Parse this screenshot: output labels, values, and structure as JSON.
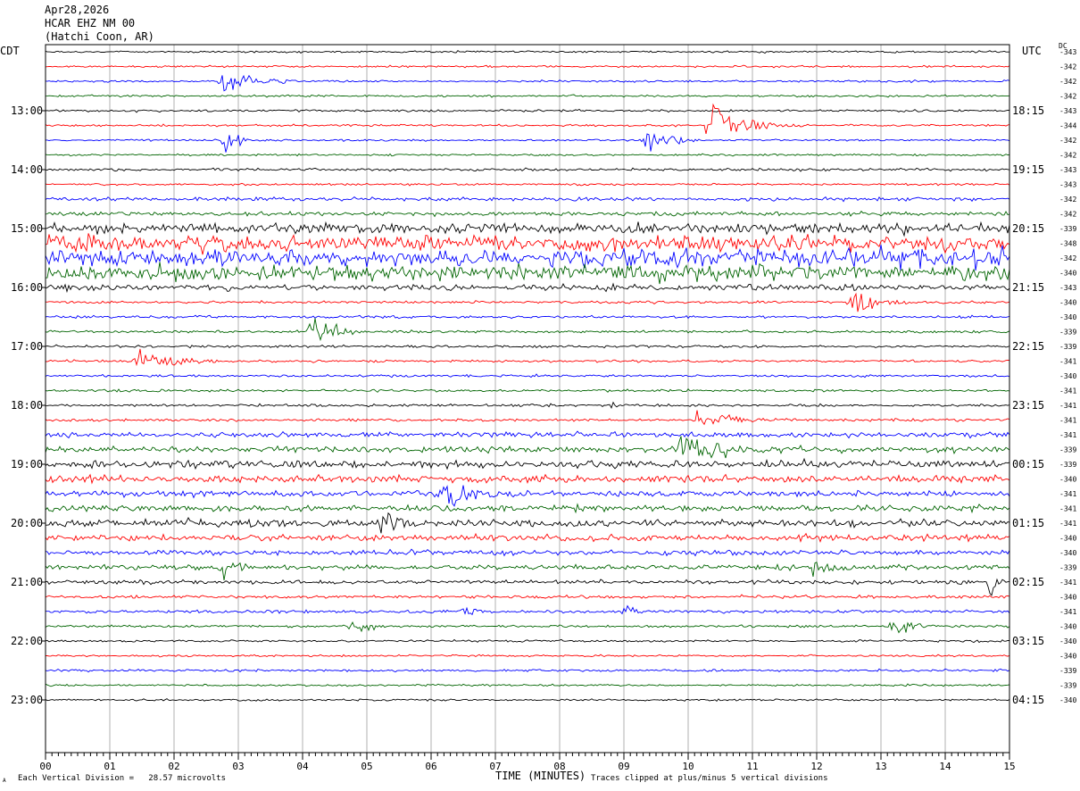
{
  "header": {
    "date": "Apr28,2026",
    "station": "HCAR EHZ NM 00",
    "location": "(Hatchi Coon, AR)"
  },
  "left_tz": "CDT",
  "right_tz": "UTC",
  "dc_label": "DC",
  "footer": {
    "scale": "Each Vertical Division =   28.57 microvolts",
    "clip": "Traces clipped at plus/minus 5 vertical divisions",
    "corner_mark": "A"
  },
  "colors": {
    "black": "#000000",
    "red": "#ff0000",
    "blue": "#0000ff",
    "green": "#006400",
    "grid": "#b0b0b0"
  },
  "chart_data": {
    "type": "line",
    "title": "",
    "xlabel": "TIME (MINUTES)",
    "ylabel": "",
    "x_ticks": [
      "00",
      "01",
      "02",
      "03",
      "04",
      "05",
      "06",
      "07",
      "08",
      "09",
      "10",
      "11",
      "12",
      "13",
      "14",
      "15"
    ],
    "xlim": [
      0,
      15
    ],
    "left_time_labels": [
      "13:00",
      "14:00",
      "15:00",
      "16:00",
      "17:00",
      "18:00",
      "19:00",
      "20:00",
      "21:00",
      "22:00",
      "23:00"
    ],
    "right_time_labels": [
      "18:15",
      "19:15",
      "20:15",
      "21:15",
      "22:15",
      "23:15",
      "00:15",
      "01:15",
      "02:15",
      "03:15",
      "04:15"
    ],
    "trace_color_cycle": [
      "black",
      "red",
      "blue",
      "green"
    ],
    "dc_offsets": [
      "-343",
      "-342",
      "-342",
      "-342",
      "-343",
      "-344",
      "-342",
      "-342",
      "-343",
      "-343",
      "-342",
      "-342",
      "-339",
      "-348",
      "-342",
      "-340",
      "-343",
      "-340",
      "-340",
      "-339",
      "-339",
      "-341",
      "-340",
      "-341",
      "-341",
      "-341",
      "-341",
      "-339",
      "-339",
      "-340",
      "-341",
      "-341",
      "-341",
      "-340",
      "-340",
      "-339",
      "-341",
      "-340",
      "-341",
      "-340",
      "-340",
      "-340",
      "-339",
      "-339",
      "-340"
    ],
    "noise_level": [
      1,
      1,
      1,
      1,
      1.1,
      1,
      1,
      1,
      1.3,
      1,
      1.8,
      2,
      5,
      8,
      9,
      8,
      3,
      1.2,
      1.3,
      1.3,
      1.2,
      1.2,
      1.2,
      1.2,
      1.3,
      1.4,
      2.5,
      3,
      3.5,
      3.5,
      3,
      3,
      3.5,
      3,
      2.5,
      2.5,
      2,
      1.5,
      1.5,
      1.2,
      1.1,
      1,
      1.2,
      1
    ],
    "events": [
      {
        "trace": 2,
        "minute": 2.8,
        "amplitude": 22,
        "duration": 0.8
      },
      {
        "trace": 6,
        "minute": 2.8,
        "amplitude": 18,
        "duration": 0.4
      },
      {
        "trace": 4,
        "minute": 1.4,
        "amplitude": 5,
        "duration": 0.1
      },
      {
        "trace": 6,
        "minute": 9.4,
        "amplitude": 16,
        "duration": 0.7
      },
      {
        "trace": 5,
        "minute": 10.4,
        "amplitude": 22,
        "duration": 1.0
      },
      {
        "trace": 17,
        "minute": 12.6,
        "amplitude": 14,
        "duration": 0.8
      },
      {
        "trace": 19,
        "minute": 4.2,
        "amplitude": 14,
        "duration": 0.8
      },
      {
        "trace": 21,
        "minute": 1.5,
        "amplitude": 18,
        "duration": 1.0
      },
      {
        "trace": 24,
        "minute": 8.8,
        "amplitude": 4,
        "duration": 0.3
      },
      {
        "trace": 25,
        "minute": 10.2,
        "amplitude": 12,
        "duration": 1.1
      },
      {
        "trace": 27,
        "minute": 10.0,
        "amplitude": 16,
        "duration": 1.3
      },
      {
        "trace": 30,
        "minute": 6.3,
        "amplitude": 16,
        "duration": 1.3
      },
      {
        "trace": 32,
        "minute": 5.3,
        "amplitude": 18,
        "duration": 0.8
      },
      {
        "trace": 35,
        "minute": 2.8,
        "amplitude": 10,
        "duration": 1.0
      },
      {
        "trace": 35,
        "minute": 12.0,
        "amplitude": 9,
        "duration": 1.0
      },
      {
        "trace": 36,
        "minute": 14.7,
        "amplitude": 14,
        "duration": 0.5
      },
      {
        "trace": 38,
        "minute": 6.5,
        "amplitude": 8,
        "duration": 0.4
      },
      {
        "trace": 38,
        "minute": 9.0,
        "amplitude": 7,
        "duration": 0.5
      },
      {
        "trace": 39,
        "minute": 4.8,
        "amplitude": 8,
        "duration": 0.6
      },
      {
        "trace": 39,
        "minute": 13.2,
        "amplitude": 8,
        "duration": 0.8
      }
    ]
  }
}
